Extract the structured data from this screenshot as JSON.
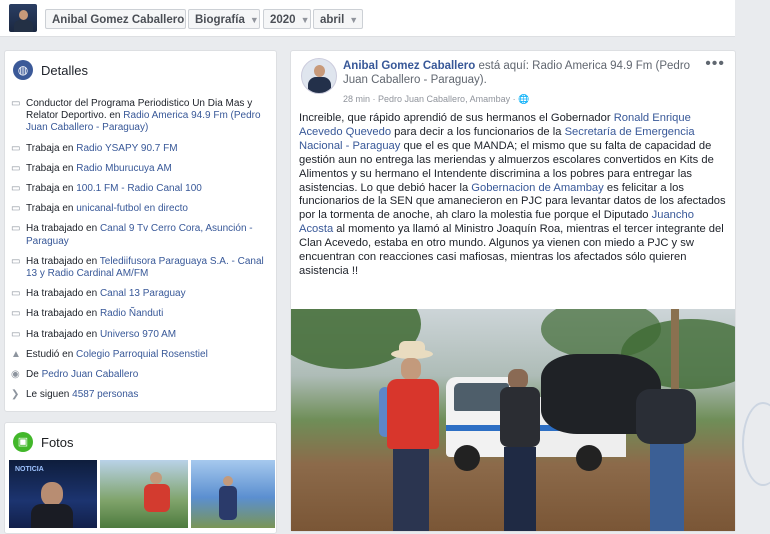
{
  "topbar": {
    "profile_name": "Anibal Gomez Caballero",
    "section": "Biografía",
    "year": "2020",
    "month": "abril"
  },
  "details": {
    "title": "Detalles",
    "items": [
      {
        "icon": "briefcase-icon",
        "prefix": "Conductor del Programa Periodistico Un Dia Mas y Relator Deportivo. en ",
        "link": "Radio America 94.9 Fm (Pedro Juan Caballero - Paraguay)"
      },
      {
        "icon": "briefcase-icon",
        "prefix": "Trabaja en ",
        "link": "Radio YSAPY 90.7 FM"
      },
      {
        "icon": "briefcase-icon",
        "prefix": "Trabaja en ",
        "link": "Radio Mburucuya AM"
      },
      {
        "icon": "briefcase-icon",
        "prefix": "Trabaja en ",
        "link": "100.1 FM - Radio Canal 100"
      },
      {
        "icon": "briefcase-icon",
        "prefix": "Trabaja en ",
        "link": "unicanal-futbol en directo"
      },
      {
        "icon": "briefcase-icon",
        "prefix": "Ha trabajado en ",
        "link": "Canal 9 Tv Cerro Cora, Asunción -Paraguay"
      },
      {
        "icon": "briefcase-icon",
        "prefix": "Ha trabajado en ",
        "link": "Telediifusora Paraguaya S.A. - Canal 13 y Radio Cardinal AM/FM"
      },
      {
        "icon": "briefcase-icon",
        "prefix": "Ha trabajado en ",
        "link": "Canal 13 Paraguay"
      },
      {
        "icon": "briefcase-icon",
        "prefix": "Ha trabajado en ",
        "link": "Radio Ñanduti"
      },
      {
        "icon": "briefcase-icon",
        "prefix": "Ha trabajado en ",
        "link": "Universo 970 AM"
      },
      {
        "icon": "graduation-cap-icon",
        "prefix": "Estudió en ",
        "link": "Colegio Parroquial Rosenstiel"
      },
      {
        "icon": "location-pin-icon",
        "prefix": "De ",
        "link": "Pedro Juan Caballero"
      },
      {
        "icon": "rss-icon",
        "prefix": "Le siguen ",
        "link": "4587 personas"
      }
    ]
  },
  "photos": {
    "title": "Fotos",
    "thumb1_caption": "NOTICIA"
  },
  "post": {
    "author": "Anibal Gomez Caballero",
    "verb": " está aquí: Radio America 94.9 Fm (Pedro Juan Caballero - Paraguay).",
    "meta": "28 min · Pedro Juan Caballero, Amambay · 🌐",
    "menu": "•••",
    "text": [
      {
        "t": "Increible, que rápido aprendió de sus hermanos el Gobernador ",
        "l": false
      },
      {
        "t": "Ronald Enrique Acevedo Quevedo",
        "l": true
      },
      {
        "t": " para decir a los funcionarios de la ",
        "l": false
      },
      {
        "t": "Secretaría de Emergencia Nacional - Paraguay",
        "l": true
      },
      {
        "t": " que el es que MANDA; el mismo que su falta de capacidad de gestión aun no entrega las meriendas y almuerzos escolares convertidos en Kits de Alimentos y su hermano el Intendente discrimina a los pobres para entregar las asistencias. Lo que debió hacer la ",
        "l": false
      },
      {
        "t": "Gobernacion de Amambay",
        "l": true
      },
      {
        "t": " es felicitar a los funcionarios de la SEN que amanecieron en PJC para levantar datos de los afectados por la tormenta de anoche, ah claro la molestia fue porque el Diputado ",
        "l": false
      },
      {
        "t": "Juancho Acosta",
        "l": true
      },
      {
        "t": " al momento ya llamó al Ministro Joaquín Roa, mientras el tercer integrante del Clan Acevedo, estaba en otro mundo. Algunos ya vienen con miedo a PJC y sw encuentran con reacciones casi mafiosas, mientras los afectados sólo quieren asistencia !!",
        "l": false
      }
    ]
  },
  "colors": {
    "link": "#385898",
    "background": "#e9ebee",
    "card": "#ffffff"
  }
}
